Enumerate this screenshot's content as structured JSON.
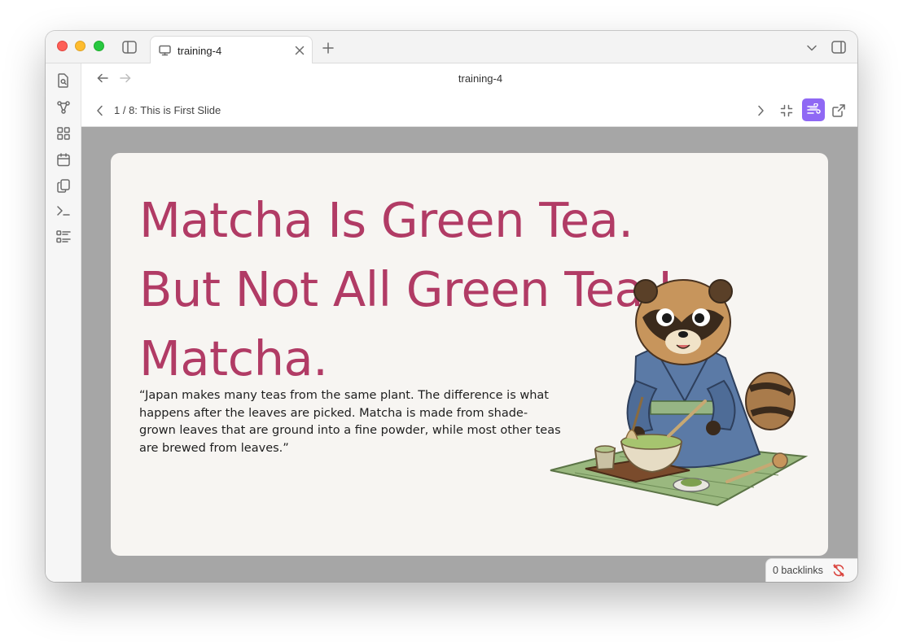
{
  "tab": {
    "title": "training-4"
  },
  "view": {
    "title": "training-4"
  },
  "slide_nav": {
    "status": "1 / 8: This is First Slide"
  },
  "slide": {
    "title": "Matcha Is Green Tea. But Not All Green Tea Is Matcha.",
    "quote": "“Japan makes many teas from the same plant. The difference is what happens after the leaves are picked. Matcha is made from shade-grown leaves that are ground into a fine powder, while most other teas are brewed from leaves.”"
  },
  "status_bar": {
    "backlinks": "0 backlinks"
  },
  "colors": {
    "accent": "#8f68f4",
    "title": "#b13b65",
    "slide_bg": "#f7f5f2",
    "stage_bg": "#a6a6a6",
    "sync_error": "#d9403a"
  },
  "icons": {
    "ribbon": [
      "file-search-icon",
      "graph-icon",
      "grid-icon",
      "calendar-icon",
      "copy-icon",
      "terminal-icon",
      "checklist-icon"
    ],
    "toolbar": [
      "chevron-right-icon",
      "collapse-icon",
      "wind-icon",
      "external-link-icon"
    ]
  }
}
